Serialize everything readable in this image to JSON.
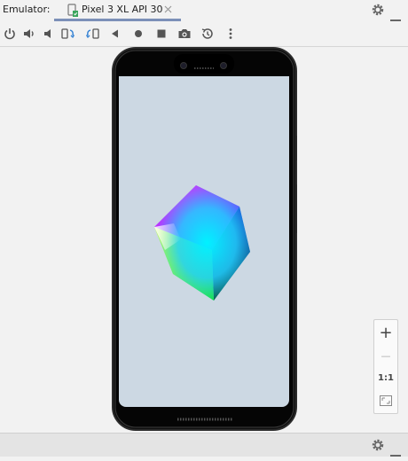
{
  "header": {
    "label": "Emulator:",
    "tab_title": "Pixel 3 XL API 30"
  },
  "toolbar": {
    "items": [
      "power-icon",
      "volume-up-icon",
      "volume-down-icon",
      "rotate-left-icon",
      "rotate-right-icon",
      "back-icon",
      "home-icon",
      "overview-icon",
      "screenshot-icon",
      "snapshot-icon",
      "more-icon"
    ]
  },
  "zoom": {
    "plus": "+",
    "minus": "—",
    "one_to_one": "1:1"
  },
  "colors": {
    "screen": "#ccd8e3",
    "phone_body": "#101010",
    "tab_underline": "#7c90b8"
  }
}
